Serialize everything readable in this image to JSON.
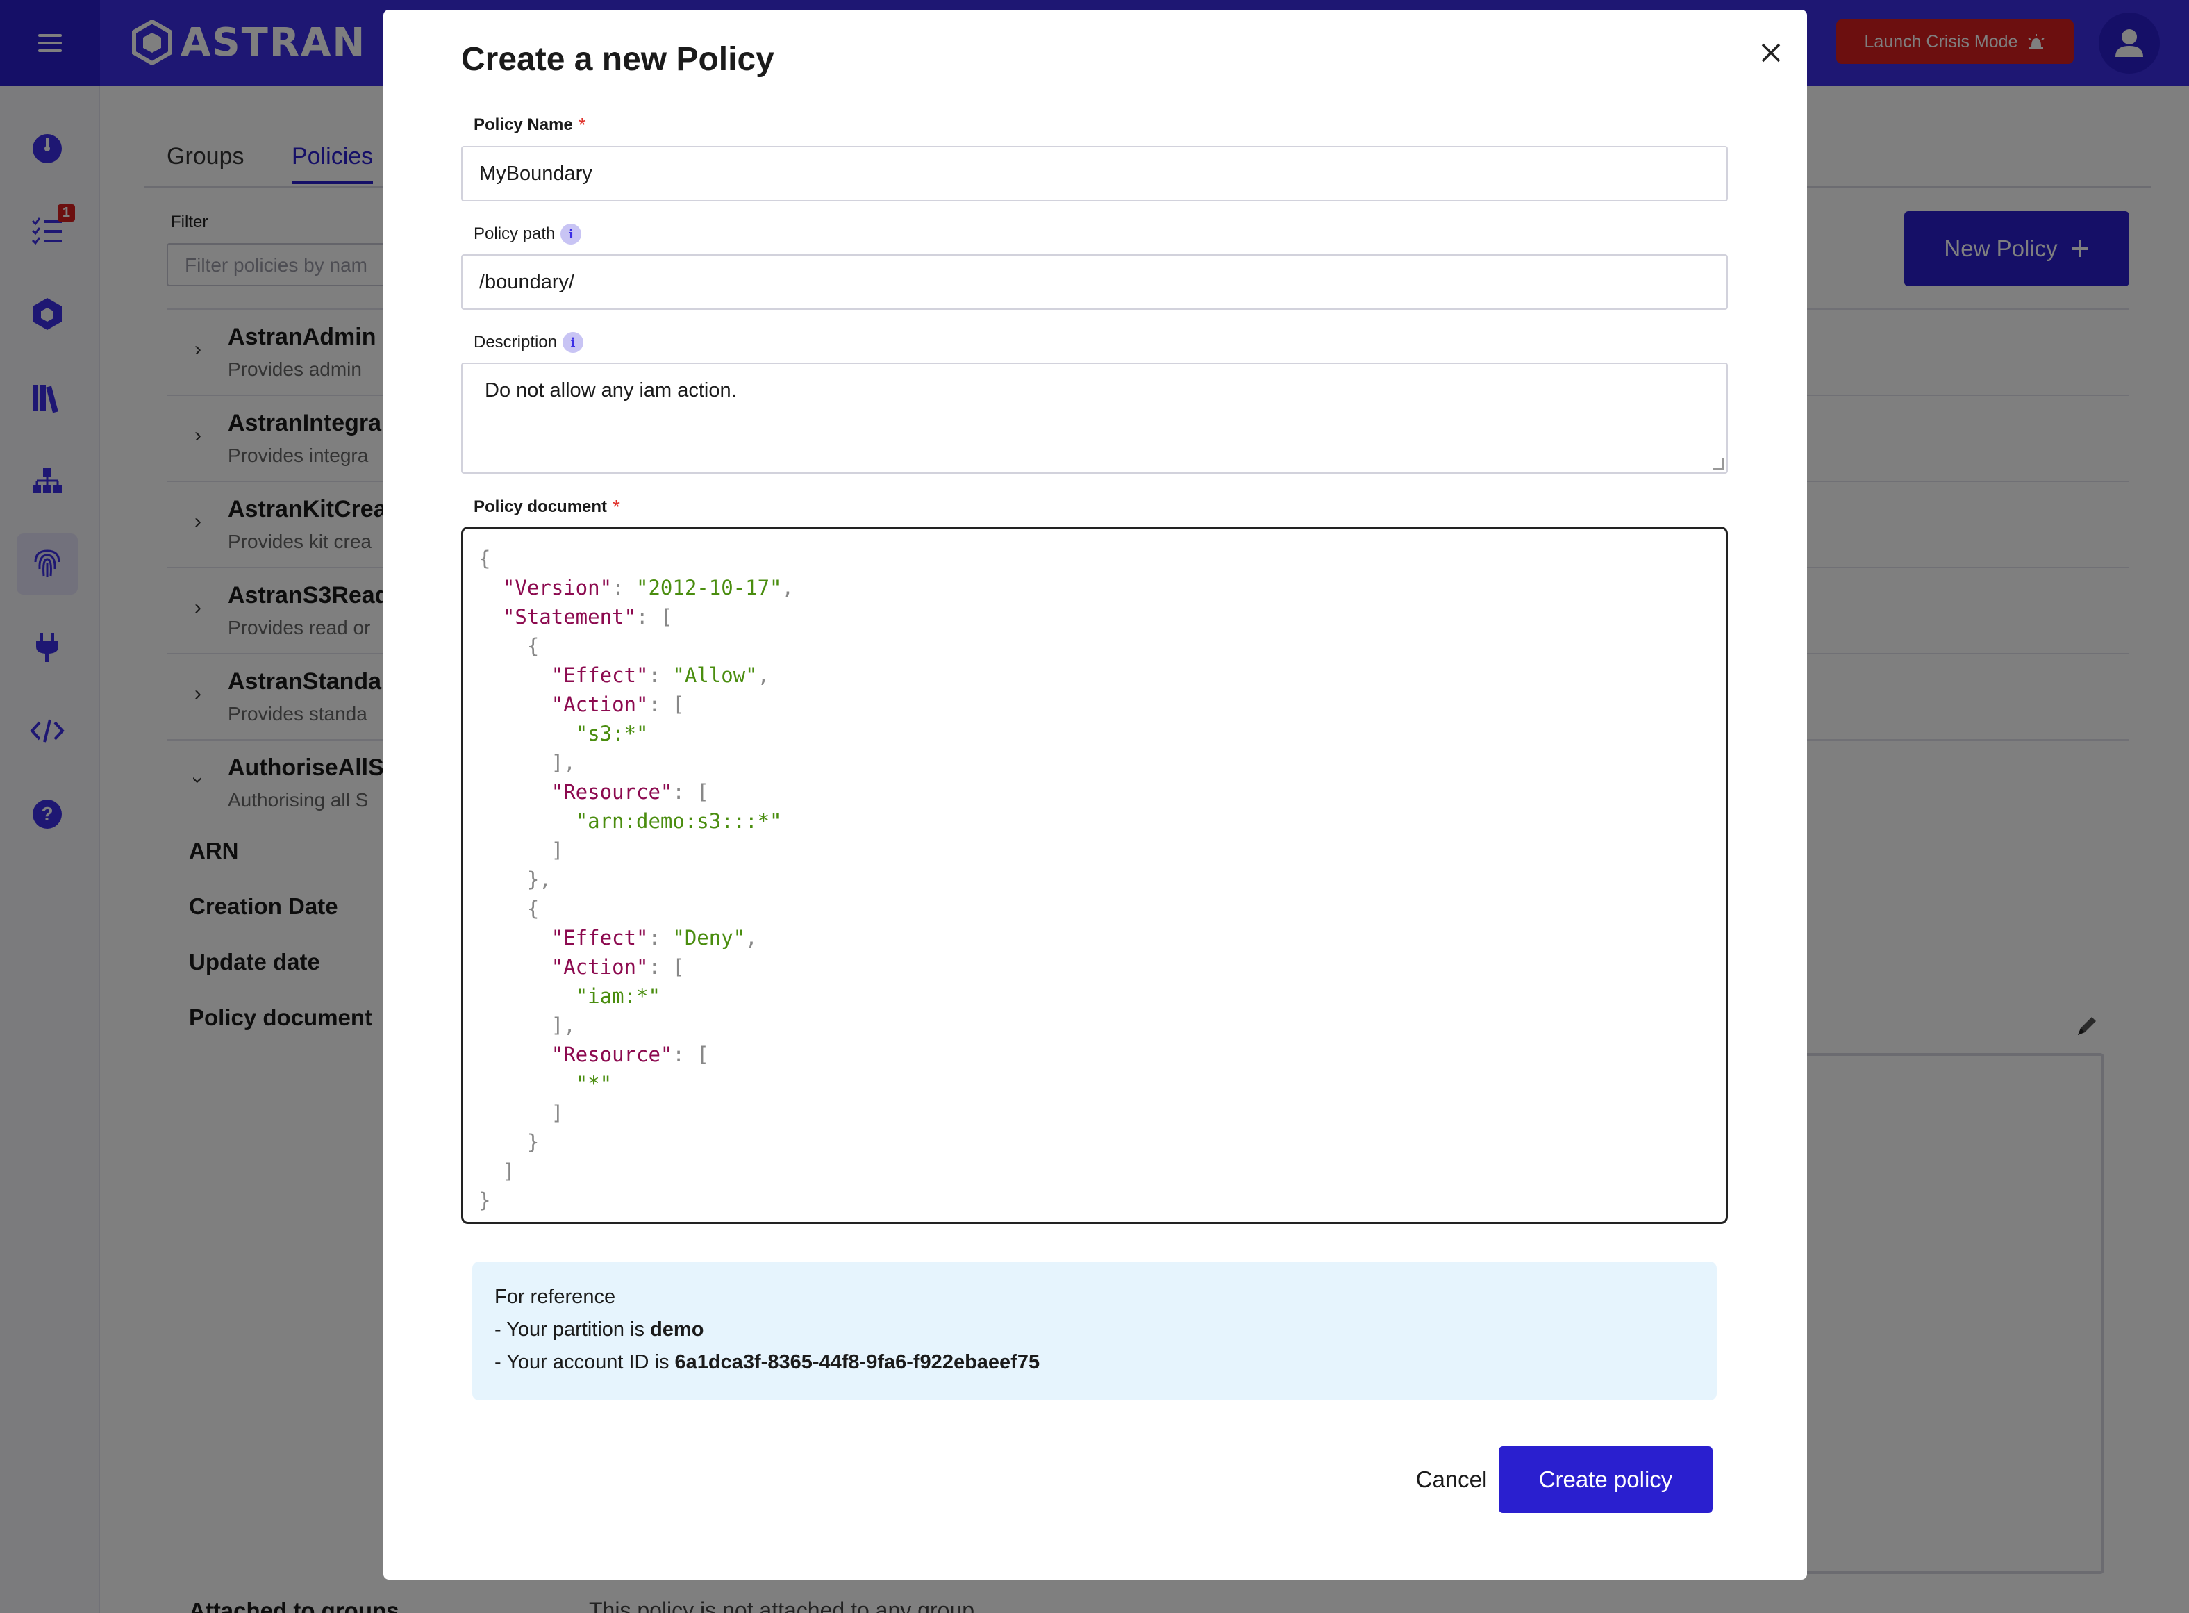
{
  "app": {
    "logo_text": "ASTRAN",
    "crisis_label": "Launch Crisis Mode",
    "brand_color": "#3c2ee6",
    "crisis_color": "#d81f1f"
  },
  "sidebar": {
    "tasks_badge": "1",
    "items": [
      "dashboard-icon",
      "tasks-icon",
      "cube-icon",
      "library-icon",
      "hierarchy-icon",
      "fingerprint-icon",
      "plug-icon",
      "code-icon",
      "help-icon"
    ]
  },
  "tabs": [
    "Groups",
    "Policies"
  ],
  "filter": {
    "label": "Filter",
    "placeholder": "Filter policies by nam"
  },
  "new_policy_label": "New Policy",
  "policies": [
    {
      "name": "AstranAdmin",
      "desc": "Provides admin"
    },
    {
      "name": "AstranIntegra",
      "desc": "Provides integra"
    },
    {
      "name": "AstranKitCrea",
      "desc": "Provides kit crea"
    },
    {
      "name": "AstranS3Read",
      "desc": "Provides read or"
    },
    {
      "name": "AstranStanda",
      "desc": "Provides standa"
    },
    {
      "name": "AuthoriseAllS",
      "desc": "Authorising all S"
    }
  ],
  "detail_labels": [
    "ARN",
    "Creation Date",
    "Update date",
    "Policy document"
  ],
  "attached": {
    "label": "Attached to groups",
    "text": "This policy is not attached to any group"
  },
  "modal": {
    "title": "Create a new Policy",
    "name_label": "Policy Name",
    "name_value": "MyBoundary",
    "path_label": "Policy path",
    "path_value": "/boundary/",
    "description_label": "Description",
    "description_value": "Do not allow any iam action.",
    "document_label": "Policy document",
    "reference_title": "For reference",
    "partition_prefix": "- Your partition is ",
    "partition": "demo",
    "account_prefix": "- Your account ID is ",
    "account_id": "6a1dca3f-8365-44f8-9fa6-f922ebaeef75",
    "cancel_label": "Cancel",
    "create_label": "Create policy"
  }
}
